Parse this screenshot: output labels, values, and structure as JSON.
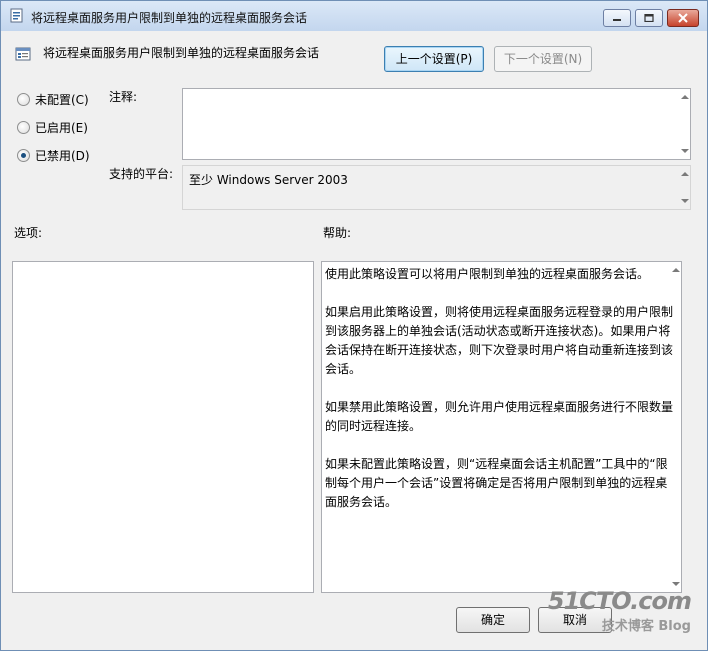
{
  "window": {
    "title": "将远程桌面服务用户限制到单独的远程桌面服务会话",
    "icons": {
      "app": "policy-icon",
      "minimize": "minimize-icon",
      "maximize": "maximize-icon",
      "close": "close-icon"
    }
  },
  "header": {
    "policy_name": "将远程桌面服务用户限制到单独的远程桌面服务会话",
    "prev_button": "上一个设置(P)",
    "next_button": "下一个设置(N)"
  },
  "state": {
    "options": [
      {
        "label": "未配置(C)",
        "selected": false
      },
      {
        "label": "已启用(E)",
        "selected": false
      },
      {
        "label": "已禁用(D)",
        "selected": true
      }
    ]
  },
  "comment": {
    "label": "注释:",
    "value": ""
  },
  "platform": {
    "label": "支持的平台:",
    "value": "至少 Windows Server 2003"
  },
  "options_panel": {
    "label": "选项:"
  },
  "help_panel": {
    "label": "帮助:",
    "paragraphs": [
      "使用此策略设置可以将用户限制到单独的远程桌面服务会话。",
      "如果启用此策略设置，则将使用远程桌面服务远程登录的用户限制到该服务器上的单独会话(活动状态或断开连接状态)。如果用户将会话保持在断开连接状态，则下次登录时用户将自动重新连接到该会话。",
      "如果禁用此策略设置，则允许用户使用远程桌面服务进行不限数量的同时远程连接。",
      "如果未配置此策略设置，则“远程桌面会话主机配置”工具中的“限制每个用户一个会话”设置将确定是否将用户限制到单独的远程桌面服务会话。"
    ]
  },
  "footer": {
    "ok_button": "确定",
    "cancel_button": "取消"
  },
  "watermark": {
    "line1": "51CTO.com",
    "line2": "技术博客",
    "line3": "Blog"
  }
}
